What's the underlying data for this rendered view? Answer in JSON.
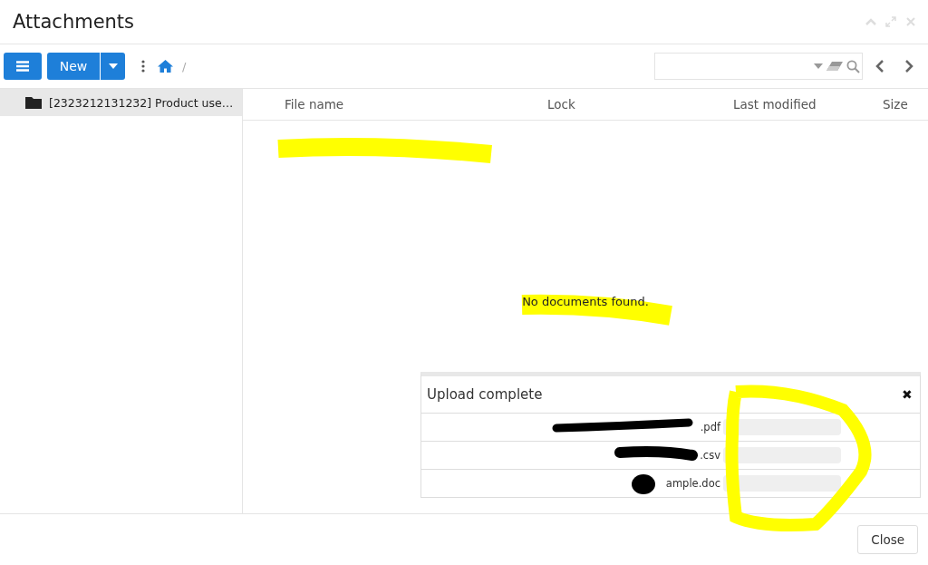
{
  "window": {
    "title": "Attachments"
  },
  "toolbar": {
    "new_label": "New",
    "breadcrumb_separator": "/"
  },
  "sidebar": {
    "items": [
      {
        "label": "[2323212131232] Product use…",
        "selected": true
      }
    ]
  },
  "table": {
    "columns": [
      "File name",
      "Lock",
      "Last modified",
      "Size"
    ],
    "empty_message": "No documents found."
  },
  "upload": {
    "title": "Upload complete",
    "close": "✖",
    "files": [
      {
        "name": ".pdf",
        "level": 1
      },
      {
        "name": ".csv",
        "level": 1
      },
      {
        "name": "ample.doc",
        "level": 1
      }
    ]
  },
  "footer": {
    "buttons": [
      "Close"
    ]
  }
}
